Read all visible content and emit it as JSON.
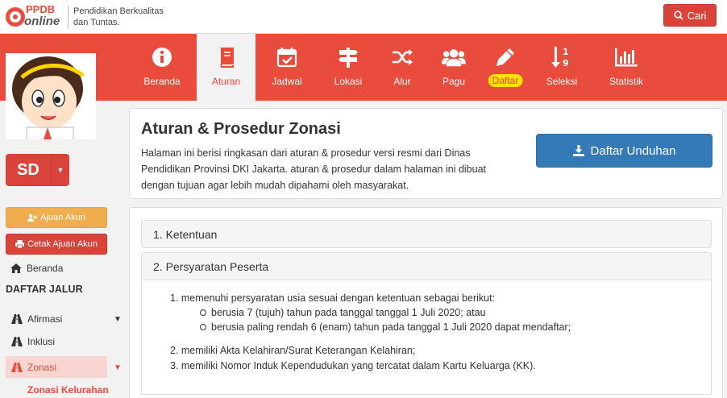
{
  "header": {
    "logo_text_top": "PPDB",
    "logo_text_bottom": "online",
    "tagline_line1": "Pendidikan Berkualitas",
    "tagline_line2": "dan Tuntas.",
    "search_label": "Cari"
  },
  "nav": {
    "items": [
      {
        "label": "Beranda",
        "icon": "info-icon"
      },
      {
        "label": "Aturan",
        "icon": "book-icon",
        "active": true
      },
      {
        "label": "Jadwal",
        "icon": "calendar-check-icon"
      },
      {
        "label": "Lokasi",
        "icon": "signpost-icon"
      },
      {
        "label": "Alur",
        "icon": "shuffle-icon"
      },
      {
        "label": "Pagu",
        "icon": "users-icon"
      },
      {
        "label": "Daftar",
        "icon": "pencil-icon",
        "highlight": true
      },
      {
        "label": "Seleksi",
        "icon": "sort-numeric-icon"
      },
      {
        "label": "Statistik",
        "icon": "bar-chart-icon"
      }
    ]
  },
  "sidebar": {
    "level": "SD",
    "ajuan_label": "Ajuan Akun",
    "cetak_label": "Cetak Ajuan Akun",
    "beranda_label": "Beranda",
    "section_title": "DAFTAR JALUR",
    "items": [
      {
        "label": "Afirmasi",
        "has_arrow": true
      },
      {
        "label": "Inklusi",
        "has_arrow": false
      },
      {
        "label": "Zonasi",
        "has_arrow": true,
        "active": true
      }
    ],
    "sub_item": "Zonasi Kelurahan"
  },
  "hero": {
    "title": "Aturan & Prosedur Zonasi",
    "description": "Halaman ini berisi ringkasan dari aturan & prosedur versi resmi dari Dinas Pendidikan Provinsi DKI Jakarta. aturan & prosedur dalam halaman ini dibuat dengan tujuan agar lebih mudah dipahami oleh masyarakat.",
    "download_label": "Daftar Unduhan"
  },
  "rules": {
    "sections": [
      {
        "title": "1. Ketentuan"
      },
      {
        "title": "2. Persyaratan Peserta"
      }
    ],
    "requirements": {
      "item1": "1. memenuhi persyaratan usia sesuai dengan ketentuan sebagai berikut:",
      "item1_sub1": "berusia 7 (tujuh) tahun pada tanggal tanggal 1 Juli 2020; atau",
      "item1_sub2": "berusia paling rendah 6 (enam) tahun pada tanggal 1 Juli 2020 dapat mendaftar;",
      "item2": "2. memiliki Akta Kelahiran/Surat Keterangan Kelahiran;",
      "item3": "3. memiliki Nomor Induk Kependudukan yang tercatat dalam Kartu Keluarga (KK)."
    }
  },
  "colors": {
    "brand_red": "#e94b3c",
    "primary_blue": "#337ab7",
    "warning": "#f0ad4e",
    "highlight_yellow": "#ffe100"
  }
}
